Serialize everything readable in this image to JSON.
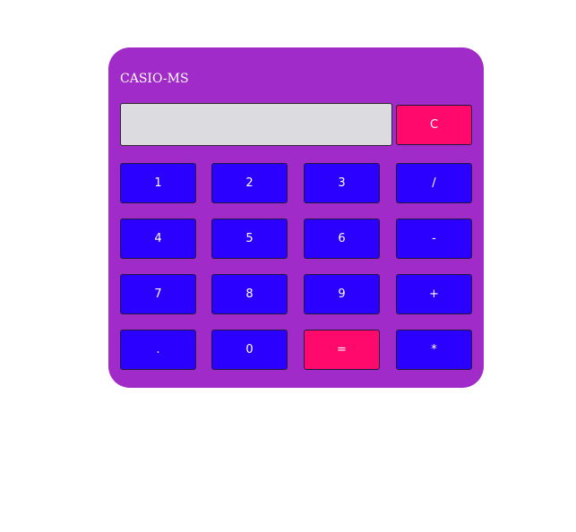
{
  "calculator": {
    "brand": "CASIO-MS",
    "display_value": "",
    "clear_label": "C",
    "colors": {
      "body": "#a02bc8",
      "display": "#dcdbe0",
      "key": "#2b00ff",
      "accent_key": "#ff0a6c"
    },
    "keys": {
      "one": "1",
      "two": "2",
      "three": "3",
      "divide": "/",
      "four": "4",
      "five": "5",
      "six": "6",
      "minus": "-",
      "seven": "7",
      "eight": "8",
      "nine": "9",
      "plus": "+",
      "decimal": ".",
      "zero": "0",
      "equals": "=",
      "multiply": "*"
    }
  }
}
